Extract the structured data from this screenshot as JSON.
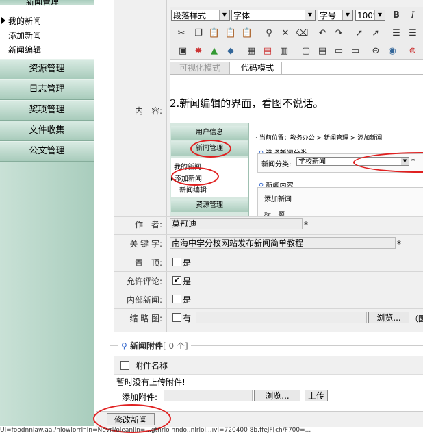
{
  "sidebar": {
    "cut_item": "新闻管理",
    "sub_items": [
      "我的新闻",
      "添加新闻",
      "新闻编辑"
    ],
    "sections": [
      "资源管理",
      "日志管理",
      "奖项管理",
      "文件收集",
      "公文管理"
    ]
  },
  "form": {
    "content_label": "内　容:",
    "editor": {
      "paragraph_style": "段落样式",
      "font": "字体",
      "font_size": "字号",
      "zoom": "100%",
      "bold": "B",
      "italic": "I",
      "tab_visual": "可视化模式",
      "tab_code": "代码模式",
      "body_text": "2.新闻编辑的界面，看图不说话。",
      "embedded_screenshot": {
        "menu_user": "用户信息",
        "menu_news": "新闻管理",
        "sub_items": [
          "我的新闻",
          "添加新闻",
          "新闻编辑"
        ],
        "menu_resource": "资源管理",
        "breadcrumb": "· 当前位置：教务办公 > 新闻管理 > 添加新闻",
        "choose_category": "选择新闻分类",
        "category_label": "新闻分类:",
        "category_value": "学校新闻",
        "news_content": "新闻内容",
        "add_news": "添加新闻",
        "title_label": "标　题"
      }
    },
    "author_label": "作　者:",
    "author_value": "莫冠迪",
    "keywords_label": "关 键 字:",
    "keywords_value": "南海中学分校网站发布新闻简单教程",
    "pin_label": "置　顶:",
    "pin_text": "是",
    "comment_label": "允许评论:",
    "comment_text": "是",
    "internal_label": "内部新闻:",
    "internal_text": "是",
    "thumb_label": "缩 略 图:",
    "thumb_text": "有",
    "browse_label": "浏览...",
    "thumb_hint": "（图",
    "required_mark": "*"
  },
  "attachments": {
    "title": "新闻附件",
    "count": "[ 0 个]",
    "col_name": "附件名称",
    "empty": "暂时没有上传附件!",
    "add_label": "添加附件:",
    "browse_label": "浏览...",
    "upload_label": "上传"
  },
  "submit_label": "修改新闻",
  "statusbar_text": "Ul=foodnnlaw.aa./nlowlorrlfiln=Nevrl/oleanlln=...gtnrlo nndo..nlrlol...ivl=720400 8b.ffeJF[ch/F700=..."
}
